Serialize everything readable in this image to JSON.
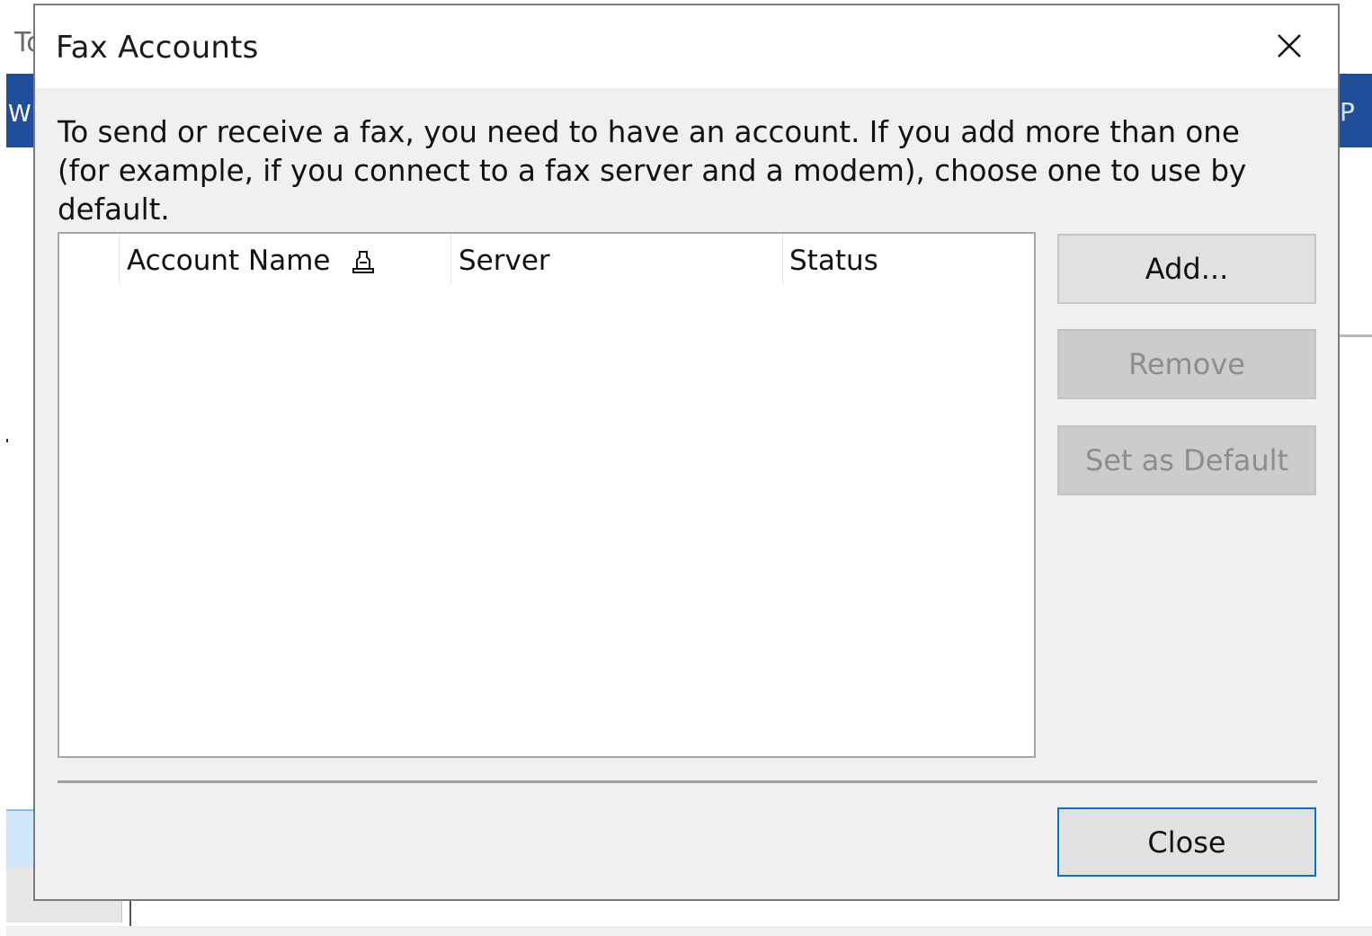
{
  "background_app": {
    "title_fragment": "To",
    "ribbon_left_fragment": "W",
    "ribbon_right_fragment": "P"
  },
  "dialog": {
    "title": "Fax Accounts",
    "description": "To send or receive a fax, you need to have an account. If you add more than one (for example, if you connect to a fax server and a modem), choose one to use by default.",
    "list": {
      "columns": [
        {
          "label": "Account Name",
          "sorted": true
        },
        {
          "label": "Server"
        },
        {
          "label": "Status"
        }
      ],
      "rows": []
    },
    "buttons": {
      "add": {
        "label": "Add...",
        "enabled": true
      },
      "remove": {
        "label": "Remove",
        "enabled": false
      },
      "set_default": {
        "label": "Set as Default",
        "enabled": false
      },
      "close": {
        "label": "Close",
        "enabled": true,
        "is_default": true
      }
    },
    "icons": {
      "close": "close-icon",
      "sort": "sort-indicator-icon"
    },
    "colors": {
      "dialog_bg": "#f0f0f0",
      "titlebar_bg": "#ffffff",
      "button_bg": "#e1e1e1",
      "disabled_button_bg": "#cccccc",
      "default_button_border": "#0a6fd1",
      "background_ribbon": "#1f4e9a"
    }
  }
}
